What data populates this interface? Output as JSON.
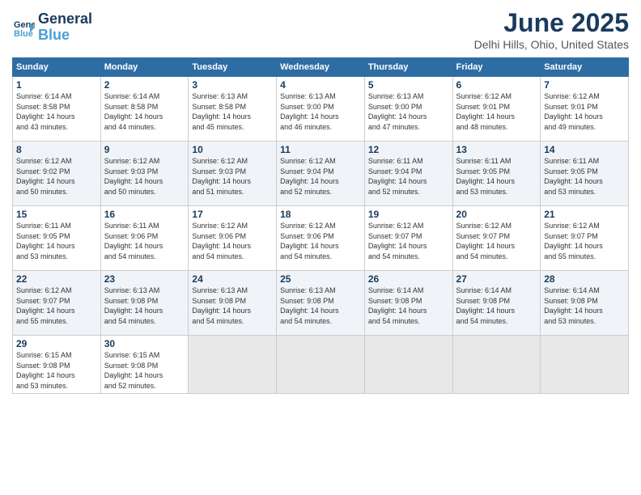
{
  "header": {
    "logo_line1": "General",
    "logo_line2": "Blue",
    "month": "June 2025",
    "location": "Delhi Hills, Ohio, United States"
  },
  "weekdays": [
    "Sunday",
    "Monday",
    "Tuesday",
    "Wednesday",
    "Thursday",
    "Friday",
    "Saturday"
  ],
  "weeks": [
    [
      {
        "day": "1",
        "sunrise": "Sunrise: 6:14 AM",
        "sunset": "Sunset: 8:58 PM",
        "daylight": "Daylight: 14 hours and 43 minutes."
      },
      {
        "day": "2",
        "sunrise": "Sunrise: 6:14 AM",
        "sunset": "Sunset: 8:58 PM",
        "daylight": "Daylight: 14 hours and 44 minutes."
      },
      {
        "day": "3",
        "sunrise": "Sunrise: 6:13 AM",
        "sunset": "Sunset: 8:58 PM",
        "daylight": "Daylight: 14 hours and 45 minutes."
      },
      {
        "day": "4",
        "sunrise": "Sunrise: 6:13 AM",
        "sunset": "Sunset: 9:00 PM",
        "daylight": "Daylight: 14 hours and 46 minutes."
      },
      {
        "day": "5",
        "sunrise": "Sunrise: 6:13 AM",
        "sunset": "Sunset: 9:00 PM",
        "daylight": "Daylight: 14 hours and 47 minutes."
      },
      {
        "day": "6",
        "sunrise": "Sunrise: 6:12 AM",
        "sunset": "Sunset: 9:01 PM",
        "daylight": "Daylight: 14 hours and 48 minutes."
      },
      {
        "day": "7",
        "sunrise": "Sunrise: 6:12 AM",
        "sunset": "Sunset: 9:01 PM",
        "daylight": "Daylight: 14 hours and 49 minutes."
      }
    ],
    [
      {
        "day": "8",
        "sunrise": "Sunrise: 6:12 AM",
        "sunset": "Sunset: 9:02 PM",
        "daylight": "Daylight: 14 hours and 50 minutes."
      },
      {
        "day": "9",
        "sunrise": "Sunrise: 6:12 AM",
        "sunset": "Sunset: 9:03 PM",
        "daylight": "Daylight: 14 hours and 50 minutes."
      },
      {
        "day": "10",
        "sunrise": "Sunrise: 6:12 AM",
        "sunset": "Sunset: 9:03 PM",
        "daylight": "Daylight: 14 hours and 51 minutes."
      },
      {
        "day": "11",
        "sunrise": "Sunrise: 6:12 AM",
        "sunset": "Sunset: 9:04 PM",
        "daylight": "Daylight: 14 hours and 52 minutes."
      },
      {
        "day": "12",
        "sunrise": "Sunrise: 6:11 AM",
        "sunset": "Sunset: 9:04 PM",
        "daylight": "Daylight: 14 hours and 52 minutes."
      },
      {
        "day": "13",
        "sunrise": "Sunrise: 6:11 AM",
        "sunset": "Sunset: 9:05 PM",
        "daylight": "Daylight: 14 hours and 53 minutes."
      },
      {
        "day": "14",
        "sunrise": "Sunrise: 6:11 AM",
        "sunset": "Sunset: 9:05 PM",
        "daylight": "Daylight: 14 hours and 53 minutes."
      }
    ],
    [
      {
        "day": "15",
        "sunrise": "Sunrise: 6:11 AM",
        "sunset": "Sunset: 9:05 PM",
        "daylight": "Daylight: 14 hours and 53 minutes."
      },
      {
        "day": "16",
        "sunrise": "Sunrise: 6:11 AM",
        "sunset": "Sunset: 9:06 PM",
        "daylight": "Daylight: 14 hours and 54 minutes."
      },
      {
        "day": "17",
        "sunrise": "Sunrise: 6:12 AM",
        "sunset": "Sunset: 9:06 PM",
        "daylight": "Daylight: 14 hours and 54 minutes."
      },
      {
        "day": "18",
        "sunrise": "Sunrise: 6:12 AM",
        "sunset": "Sunset: 9:06 PM",
        "daylight": "Daylight: 14 hours and 54 minutes."
      },
      {
        "day": "19",
        "sunrise": "Sunrise: 6:12 AM",
        "sunset": "Sunset: 9:07 PM",
        "daylight": "Daylight: 14 hours and 54 minutes."
      },
      {
        "day": "20",
        "sunrise": "Sunrise: 6:12 AM",
        "sunset": "Sunset: 9:07 PM",
        "daylight": "Daylight: 14 hours and 54 minutes."
      },
      {
        "day": "21",
        "sunrise": "Sunrise: 6:12 AM",
        "sunset": "Sunset: 9:07 PM",
        "daylight": "Daylight: 14 hours and 55 minutes."
      }
    ],
    [
      {
        "day": "22",
        "sunrise": "Sunrise: 6:12 AM",
        "sunset": "Sunset: 9:07 PM",
        "daylight": "Daylight: 14 hours and 55 minutes."
      },
      {
        "day": "23",
        "sunrise": "Sunrise: 6:13 AM",
        "sunset": "Sunset: 9:08 PM",
        "daylight": "Daylight: 14 hours and 54 minutes."
      },
      {
        "day": "24",
        "sunrise": "Sunrise: 6:13 AM",
        "sunset": "Sunset: 9:08 PM",
        "daylight": "Daylight: 14 hours and 54 minutes."
      },
      {
        "day": "25",
        "sunrise": "Sunrise: 6:13 AM",
        "sunset": "Sunset: 9:08 PM",
        "daylight": "Daylight: 14 hours and 54 minutes."
      },
      {
        "day": "26",
        "sunrise": "Sunrise: 6:14 AM",
        "sunset": "Sunset: 9:08 PM",
        "daylight": "Daylight: 14 hours and 54 minutes."
      },
      {
        "day": "27",
        "sunrise": "Sunrise: 6:14 AM",
        "sunset": "Sunset: 9:08 PM",
        "daylight": "Daylight: 14 hours and 54 minutes."
      },
      {
        "day": "28",
        "sunrise": "Sunrise: 6:14 AM",
        "sunset": "Sunset: 9:08 PM",
        "daylight": "Daylight: 14 hours and 53 minutes."
      }
    ],
    [
      {
        "day": "29",
        "sunrise": "Sunrise: 6:15 AM",
        "sunset": "Sunset: 9:08 PM",
        "daylight": "Daylight: 14 hours and 53 minutes."
      },
      {
        "day": "30",
        "sunrise": "Sunrise: 6:15 AM",
        "sunset": "Sunset: 9:08 PM",
        "daylight": "Daylight: 14 hours and 52 minutes."
      },
      null,
      null,
      null,
      null,
      null
    ]
  ]
}
